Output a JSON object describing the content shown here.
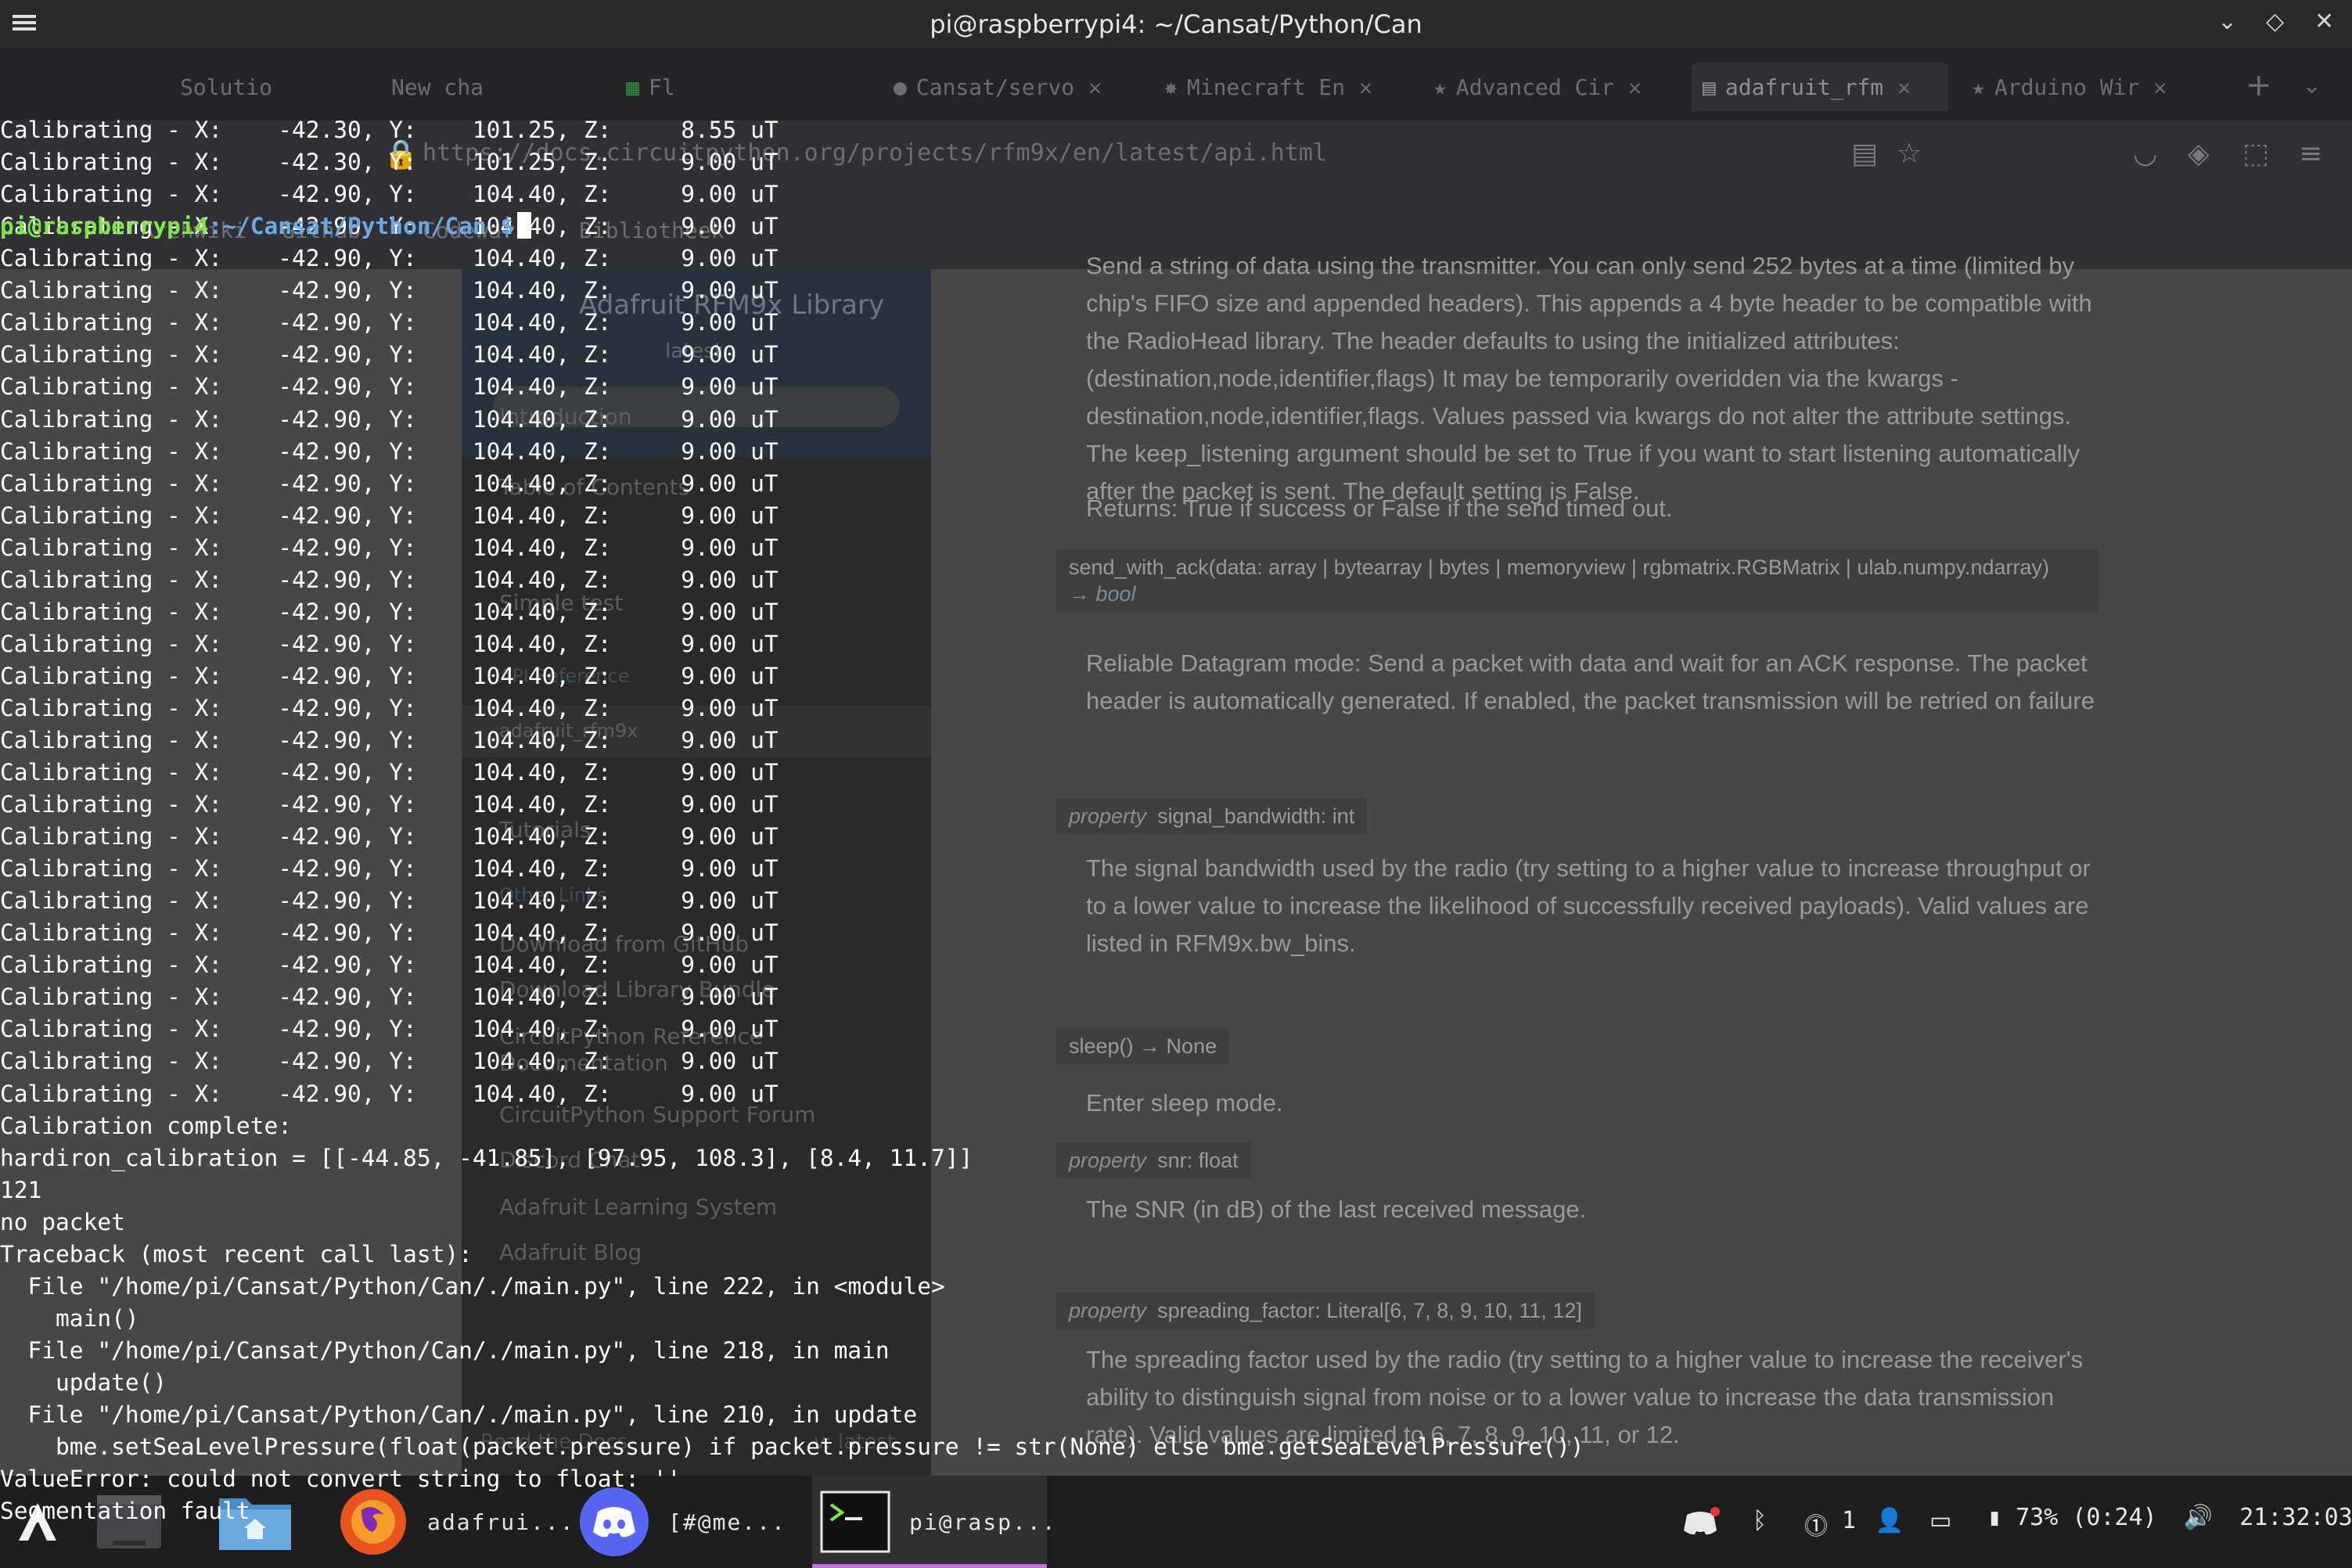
{
  "terminal": {
    "title": "pi@raspberrypi4: ~/Cansat/Python/Can",
    "lines": [
      "Calibrating - X:    -42.30, Y:    101.25, Z:     8.55 uT",
      "Calibrating - X:    -42.30, Y:    101.25, Z:     9.00 uT",
      "Calibrating - X:    -42.90, Y:    104.40, Z:     9.00 uT",
      "Calibrating - X:    -42.90, Y:    104.40, Z:     9.00 uT",
      "Calibrating - X:    -42.90, Y:    104.40, Z:     9.00 uT",
      "Calibrating - X:    -42.90, Y:    104.40, Z:     9.00 uT",
      "Calibrating - X:    -42.90, Y:    104.40, Z:     9.00 uT",
      "Calibrating - X:    -42.90, Y:    104.40, Z:     9.00 uT",
      "Calibrating - X:    -42.90, Y:    104.40, Z:     9.00 uT",
      "Calibrating - X:    -42.90, Y:    104.40, Z:     9.00 uT",
      "Calibrating - X:    -42.90, Y:    104.40, Z:     9.00 uT",
      "Calibrating - X:    -42.90, Y:    104.40, Z:     9.00 uT",
      "Calibrating - X:    -42.90, Y:    104.40, Z:     9.00 uT",
      "Calibrating - X:    -42.90, Y:    104.40, Z:     9.00 uT",
      "Calibrating - X:    -42.90, Y:    104.40, Z:     9.00 uT",
      "Calibrating - X:    -42.90, Y:    104.40, Z:     9.00 uT",
      "Calibrating - X:    -42.90, Y:    104.40, Z:     9.00 uT",
      "Calibrating - X:    -42.90, Y:    104.40, Z:     9.00 uT",
      "Calibrating - X:    -42.90, Y:    104.40, Z:     9.00 uT",
      "Calibrating - X:    -42.90, Y:    104.40, Z:     9.00 uT",
      "Calibrating - X:    -42.90, Y:    104.40, Z:     9.00 uT",
      "Calibrating - X:    -42.90, Y:    104.40, Z:     9.00 uT",
      "Calibrating - X:    -42.90, Y:    104.40, Z:     9.00 uT",
      "Calibrating - X:    -42.90, Y:    104.40, Z:     9.00 uT",
      "Calibrating - X:    -42.90, Y:    104.40, Z:     9.00 uT",
      "Calibrating - X:    -42.90, Y:    104.40, Z:     9.00 uT",
      "Calibrating - X:    -42.90, Y:    104.40, Z:     9.00 uT",
      "Calibrating - X:    -42.90, Y:    104.40, Z:     9.00 uT",
      "Calibrating - X:    -42.90, Y:    104.40, Z:     9.00 uT",
      "Calibrating - X:    -42.90, Y:    104.40, Z:     9.00 uT",
      "Calibrating - X:    -42.90, Y:    104.40, Z:     9.00 uT",
      "Calibration complete:",
      "hardiron_calibration = [[-44.85, -41.85], [97.95, 108.3], [8.4, 11.7]]",
      "121",
      "no packet",
      "Traceback (most recent call last):",
      "  File \"/home/pi/Cansat/Python/Can/./main.py\", line 222, in <module>",
      "    main()",
      "  File \"/home/pi/Cansat/Python/Can/./main.py\", line 218, in main",
      "    update()",
      "  File \"/home/pi/Cansat/Python/Can/./main.py\", line 210, in update",
      "    bme.setSeaLevelPressure(float(packet.pressure) if packet.pressure != str(None) else bme.getSeaLevelPressure())",
      "ValueError: could not convert string to float: ''",
      "Segmentation fault"
    ],
    "prompt_user": "pi@raspberrypi4",
    "prompt_path": ":~/Cansat/Python/Can",
    "prompt_symbol": " $"
  },
  "browser": {
    "tabs": [
      {
        "label": "Solutio"
      },
      {
        "label": "New cha"
      },
      {
        "label": "Fl"
      },
      {
        "label": "Cansat/servo"
      },
      {
        "label": "Minecraft En"
      },
      {
        "label": "Advanced Cir"
      },
      {
        "label": "adafruit_rfm"
      },
      {
        "label": "Arduino Wir"
      }
    ],
    "url": "https://docs.circuitpython.org/projects/rfm9x/en/latest/api.html",
    "bookmarks": [
      "Archwiki",
      "Github",
      "Codewars",
      "Bibliotheek"
    ],
    "sidebar": {
      "title": "Adafruit RFM9x Library",
      "version": "latest",
      "links": [
        "Introduction",
        "Table of Contents",
        "Simple test",
        "API Reference",
        "adafruit_rfm9x",
        "Related Products",
        "Tutorials",
        "Other Links",
        "Download from GitHub",
        "Download Library Bundle",
        "CircuitPython Reference Documentation",
        "CircuitPython Support Forum",
        "Discord Chat",
        "Adafruit Learning System",
        "Adafruit Blog",
        "Adafruit Store"
      ],
      "footer": "Read the Docs",
      "footer_version": "v: latest"
    },
    "doc": {
      "p1": "Send a string of data using the transmitter. You can only send 252 bytes at a time (limited by chip's FIFO size and appended headers). This appends a 4 byte header to be compatible with the RadioHead library. The header defaults to using the initialized attributes: (destination,node,identifier,flags) It may be temporarily overidden via the kwargs - destination,node,identifier,flags. Values passed via kwargs do not alter the attribute settings. The keep_listening argument should be set to True if you want to start listening automatically after the packet is sent. The default setting is False.",
      "p1_returns": "Returns: True if success or False if the send timed out.",
      "sig_send_with_ack": "send_with_ack(data: array | bytearray | bytes | memoryview | rgbmatrix.RGBMatrix | ulab.numpy.ndarray)",
      "sig_send_with_ack_ret": "→ bool",
      "p2": "Reliable Datagram mode: Send a packet with data and wait for an ACK response. The packet header is automatically generated. If enabled, the packet transmission will be retried on failure",
      "sig_bandwidth_kw": "property",
      "sig_bandwidth": "signal_bandwidth: int",
      "p3": "The signal bandwidth used by the radio (try setting to a higher value to increase throughput or to a lower value to increase the likelihood of successfully received payloads). Valid values are listed in RFM9x.bw_bins.",
      "sig_sleep": "sleep() → None",
      "p4": "Enter sleep mode.",
      "sig_snr_kw": "property",
      "sig_snr": "snr: float",
      "p5": "The SNR (in dB) of the last received message.",
      "sig_sf_kw": "property",
      "sig_sf": "spreading_factor: Literal[6, 7, 8, 9, 10, 11, 12]",
      "p6": "The spreading factor used by the radio (try setting to a higher value to increase the receiver's ability to distinguish signal from noise or to a lower value to increase the data transmission rate). Valid values are limited to 6, 7, 8, 9, 10, 11, or 12."
    }
  },
  "taskbar": {
    "firefox_label": "adafrui...",
    "discord_label": "[#@me...",
    "terminal_label": "pi@rasp...",
    "notification_count": "1",
    "battery": "73%",
    "battery_time": "(0:24)",
    "clock": "21:32:03"
  },
  "colors": {
    "prompt_user": "#7fe64a",
    "prompt_path": "#6aa8e6",
    "active_task_accent": "#c06ed8"
  }
}
